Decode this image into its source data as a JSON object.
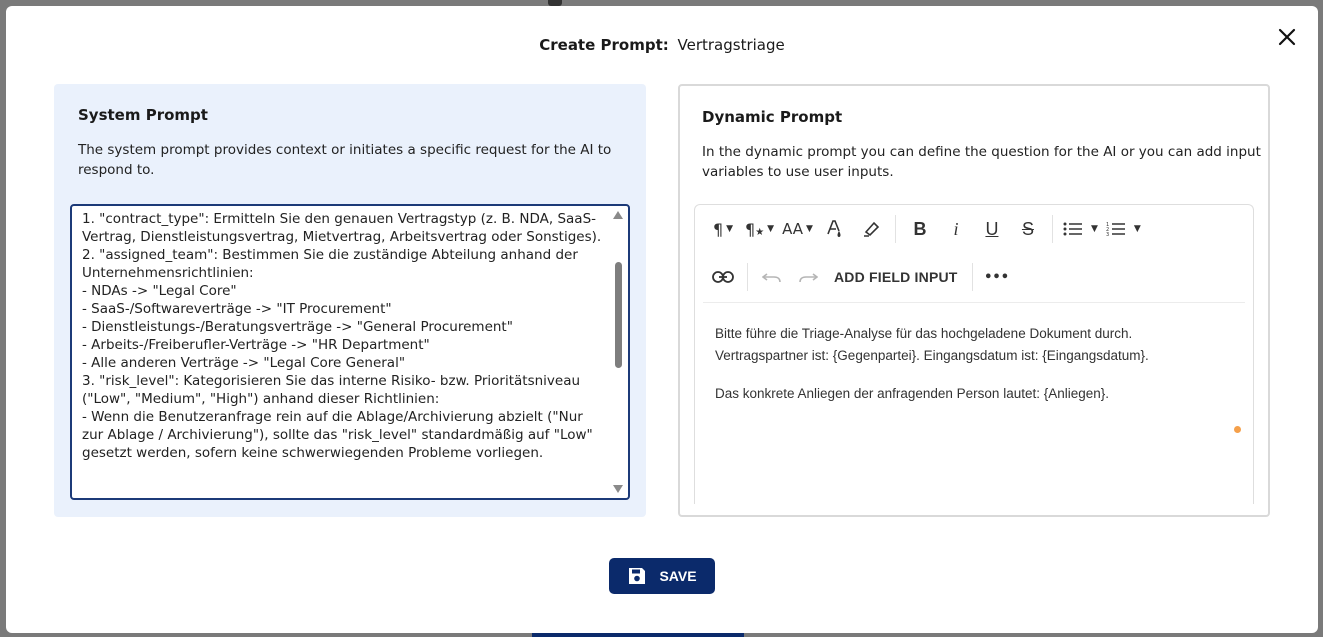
{
  "modal": {
    "title_label": "Create Prompt:",
    "title_value": "Vertragstriage"
  },
  "system_prompt": {
    "heading": "System Prompt",
    "description": "The system prompt provides context or initiates a specific request for the AI to respond to.",
    "text": "1. \"contract_type\": Ermitteln Sie den genauen Vertragstyp (z. B. NDA, SaaS-Vertrag, Dienstleistungsvertrag, Mietvertrag, Arbeitsvertrag oder Sonstiges).\n2. \"assigned_team\": Bestimmen Sie die zuständige Abteilung anhand der Unternehmensrichtlinien:\n- NDAs -> \"Legal Core\"\n- SaaS-/Softwareverträge -> \"IT Procurement\"\n- Dienstleistungs-/Beratungsverträge -> \"General Procurement\"\n- Arbeits-/Freiberufler-Verträge -> \"HR Department\"\n- Alle anderen Verträge -> \"Legal Core General\"\n3. \"risk_level\": Kategorisieren Sie das interne Risiko- bzw. Prioritätsniveau (\"Low\", \"Medium\", \"High\") anhand dieser Richtlinien:\n- Wenn die Benutzeranfrage rein auf die Ablage/Archivierung abzielt (\"Nur zur Ablage / Archivierung\"), sollte das \"risk_level\" standardmäßig auf \"Low\" gesetzt werden, sofern keine schwerwiegenden Probleme vorliegen."
  },
  "dynamic_prompt": {
    "heading": "Dynamic Prompt",
    "description": "In the dynamic prompt you can define the question for the AI or you can add input variables to use user inputs.",
    "toolbar": {
      "add_field_input": "ADD FIELD INPUT",
      "bold": "B",
      "italic": "i",
      "underline": "U",
      "strikethrough": "S",
      "font_size": "AA",
      "more": "•••"
    },
    "body": {
      "line1": "Bitte führe die Triage-Analyse für das hochgeladene Dokument durch.",
      "line2": "Vertragspartner ist: {Gegenpartei}. Eingangsdatum ist: {Eingangsdatum}.",
      "line3": "Das konkrete Anliegen der anfragenden Person lautet: {Anliegen}."
    }
  },
  "actions": {
    "save_label": "SAVE"
  },
  "colors": {
    "primary": "#0b2a6b",
    "left_panel_bg": "#eaf1fc",
    "textarea_border": "#1c3a78",
    "indicator": "#f5a04a"
  }
}
